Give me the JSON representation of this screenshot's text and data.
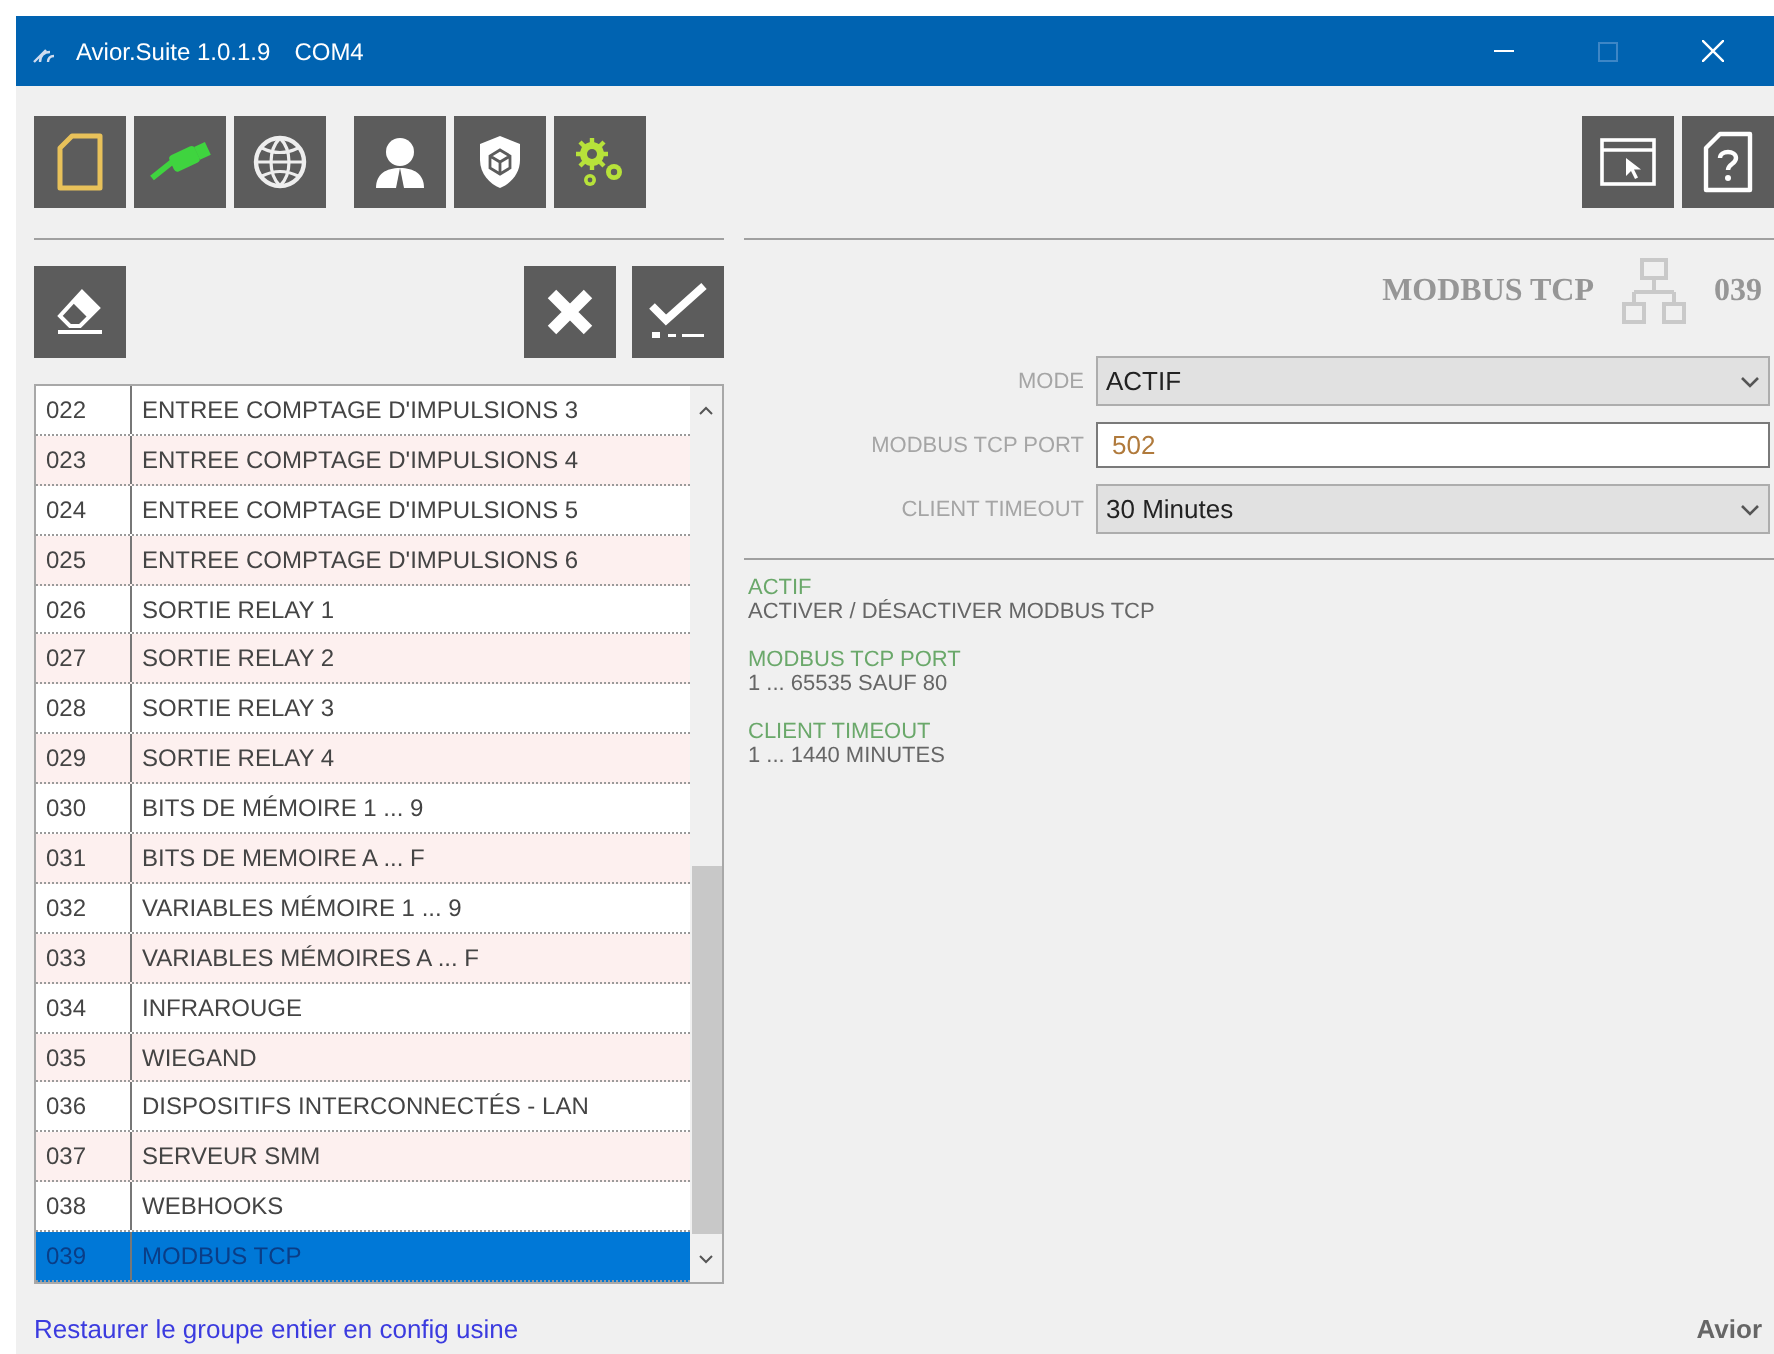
{
  "window": {
    "title": "Avior.Suite 1.0.1.9",
    "port": "COM4"
  },
  "list": {
    "rows": [
      {
        "number": "022",
        "label": "ENTREE COMPTAGE D'IMPULSIONS 3",
        "selected": false
      },
      {
        "number": "023",
        "label": "ENTREE COMPTAGE D'IMPULSIONS 4",
        "selected": false
      },
      {
        "number": "024",
        "label": "ENTREE COMPTAGE D'IMPULSIONS 5",
        "selected": false
      },
      {
        "number": "025",
        "label": "ENTREE COMPTAGE D'IMPULSIONS 6",
        "selected": false
      },
      {
        "number": "026",
        "label": "SORTIE RELAY 1",
        "selected": false
      },
      {
        "number": "027",
        "label": "SORTIE RELAY 2",
        "selected": false
      },
      {
        "number": "028",
        "label": "SORTIE RELAY 3",
        "selected": false
      },
      {
        "number": "029",
        "label": "SORTIE RELAY 4",
        "selected": false
      },
      {
        "number": "030",
        "label": "BITS DE MÉMOIRE 1 ... 9",
        "selected": false
      },
      {
        "number": "031",
        "label": "BITS DE MEMOIRE A ... F",
        "selected": false
      },
      {
        "number": "032",
        "label": "VARIABLES MÉMOIRE 1 ... 9",
        "selected": false
      },
      {
        "number": "033",
        "label": "VARIABLES MÉMOIRES A ... F",
        "selected": false
      },
      {
        "number": "034",
        "label": "INFRAROUGE",
        "selected": false
      },
      {
        "number": "035",
        "label": "WIEGAND",
        "selected": false
      },
      {
        "number": "036",
        "label": "DISPOSITIFS INTERCONNECTÉS - LAN",
        "selected": false
      },
      {
        "number": "037",
        "label": "SERVEUR SMM",
        "selected": false
      },
      {
        "number": "038",
        "label": "WEBHOOKS",
        "selected": false
      },
      {
        "number": "039",
        "label": "MODBUS TCP",
        "selected": true
      }
    ]
  },
  "header": {
    "title": "MODBUS TCP",
    "number": "039"
  },
  "fields": [
    {
      "kind": "select",
      "label": "MODE",
      "value": "ACTIF"
    },
    {
      "kind": "input",
      "label": "MODBUS TCP PORT",
      "value": "502"
    },
    {
      "kind": "select",
      "label": "CLIENT TIMEOUT",
      "value": "30 Minutes"
    }
  ],
  "help": [
    {
      "title": "ACTIF",
      "text": "ACTIVER / DÉSACTIVER MODBUS TCP"
    },
    {
      "title": "MODBUS TCP PORT",
      "text": "1 ... 65535 SAUF 80"
    },
    {
      "title": "CLIENT TIMEOUT",
      "text": "1 ... 1440 MINUTES"
    }
  ],
  "footer": {
    "link": "Restaurer le groupe entier en config usine",
    "brand": "Avior"
  }
}
